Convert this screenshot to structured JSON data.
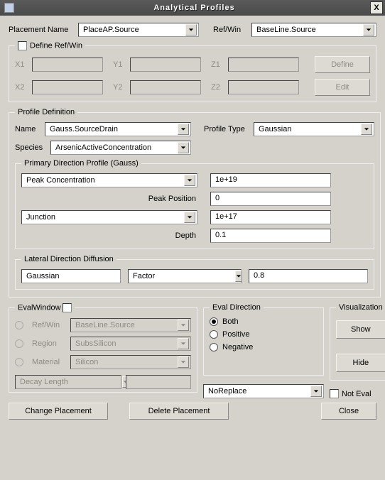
{
  "window": {
    "title": "Analytical Profiles",
    "close": "X"
  },
  "top": {
    "placement_label": "Placement Name",
    "placement_value": "PlaceAP.Source",
    "refwin_label": "Ref/Win",
    "refwin_value": "BaseLine.Source"
  },
  "define_refwin": {
    "legend": "Define Ref/Win",
    "x1": "X1",
    "y1": "Y1",
    "z1": "Z1",
    "x2": "X2",
    "y2": "Y2",
    "z2": "Z2",
    "define_btn": "Define",
    "edit_btn": "Edit"
  },
  "profile_def": {
    "legend": "Profile Definition",
    "name_label": "Name",
    "name_value": "Gauss.SourceDrain",
    "ptype_label": "Profile Type",
    "ptype_value": "Gaussian",
    "species_label": "Species",
    "species_value": "ArsenicActiveConcentration"
  },
  "primary": {
    "legend": "Primary Direction Profile (Gauss)",
    "peak_conc_combo": "Peak Concentration",
    "peak_conc_val": "1e+19",
    "peak_pos_label": "Peak Position",
    "peak_pos_val": "0",
    "junction_combo": "Junction",
    "junction_val": "1e+17",
    "depth_label": "Depth",
    "depth_val": "0.1"
  },
  "lateral": {
    "legend": "Lateral Direction Diffusion",
    "method": "Gaussian",
    "factor": "Factor",
    "value": "0.8"
  },
  "evalwin": {
    "legend": "EvalWindow",
    "refwin_label": "Ref/Win",
    "refwin_value": "BaseLine.Source",
    "region_label": "Region",
    "region_value": "SubsSilicon",
    "material_label": "Material",
    "material_value": "Silicon",
    "decay_label": "Decay Length"
  },
  "evaldir": {
    "legend": "Eval Direction",
    "both": "Both",
    "positive": "Positive",
    "negative": "Negative",
    "noreplace": "NoReplace"
  },
  "viz": {
    "legend": "Visualization",
    "show": "Show",
    "hide": "Hide",
    "noteval": "Not Eval"
  },
  "bottom": {
    "change": "Change Placement",
    "delete": "Delete Placement",
    "close": "Close"
  }
}
